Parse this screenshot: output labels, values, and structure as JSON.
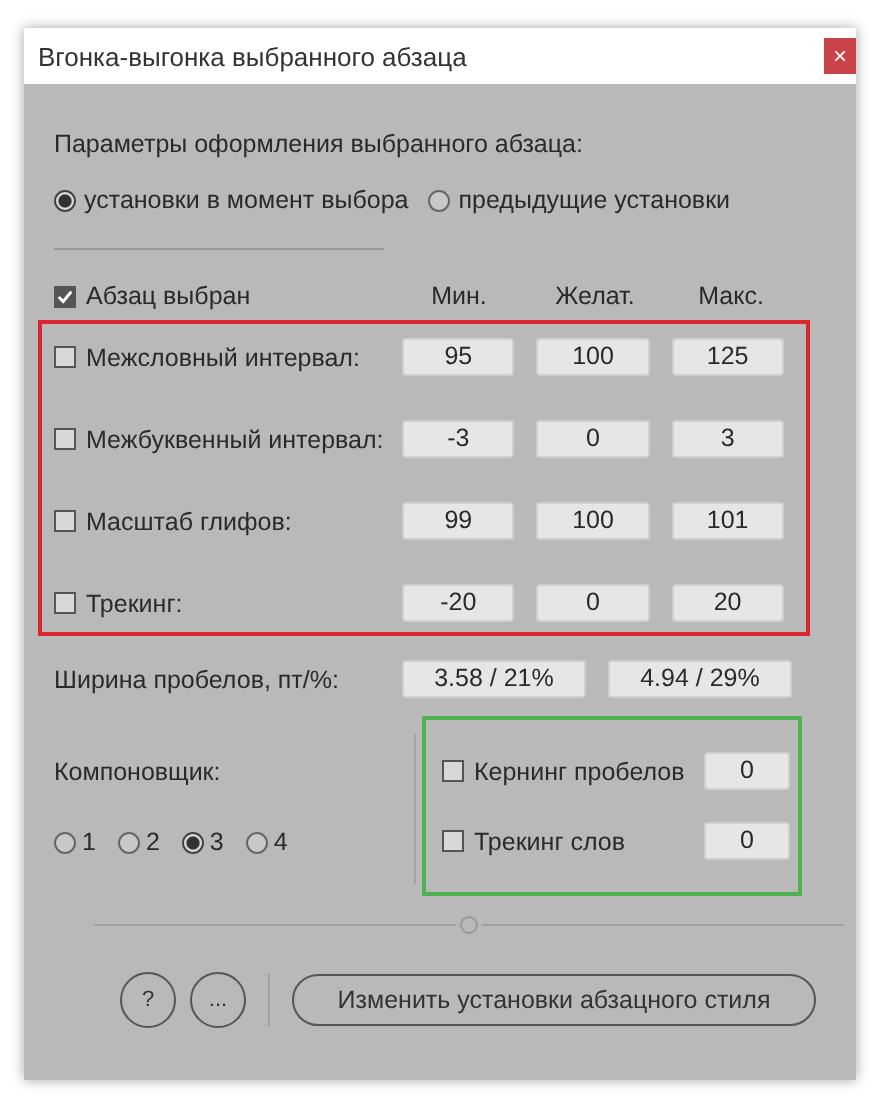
{
  "window": {
    "title": "Вгонка-выгонка выбранного абзаца",
    "close": "×"
  },
  "style_source": {
    "label": "Параметры оформления выбранного абзаца:",
    "options": [
      {
        "label": "установки в момент выбора",
        "selected": true
      },
      {
        "label": "предыдущие установки",
        "selected": false
      }
    ]
  },
  "paragraph_selected": {
    "label": "Абзац выбран",
    "checked": true
  },
  "columns": [
    "Мин.",
    "Желат.",
    "Макс."
  ],
  "rows": [
    {
      "label": "Межсловный интервал:",
      "checked": false,
      "values": [
        "95",
        "100",
        "125"
      ]
    },
    {
      "label": "Межбуквенный интервал:",
      "checked": false,
      "values": [
        "-3",
        "0",
        "3"
      ]
    },
    {
      "label": "Масштаб глифов:",
      "checked": false,
      "values": [
        "99",
        "100",
        "101"
      ]
    },
    {
      "label": "Трекинг:",
      "checked": false,
      "values": [
        "-20",
        "0",
        "20"
      ]
    }
  ],
  "space_width": {
    "label": "Ширина пробелов, пт/%:",
    "values": [
      "3.58 / 21%",
      "4.94 / 29%"
    ]
  },
  "composer": {
    "label": "Компоновщик:",
    "options": [
      {
        "label": "1",
        "selected": false
      },
      {
        "label": "2",
        "selected": false
      },
      {
        "label": "3",
        "selected": true
      },
      {
        "label": "4",
        "selected": false
      }
    ]
  },
  "extras": [
    {
      "label": "Кернинг пробелов",
      "checked": false,
      "value": "0"
    },
    {
      "label": "Трекинг слов",
      "checked": false,
      "value": "0"
    }
  ],
  "buttons": {
    "help": "?",
    "more": "...",
    "apply": "Изменить установки абзацного стиля"
  }
}
